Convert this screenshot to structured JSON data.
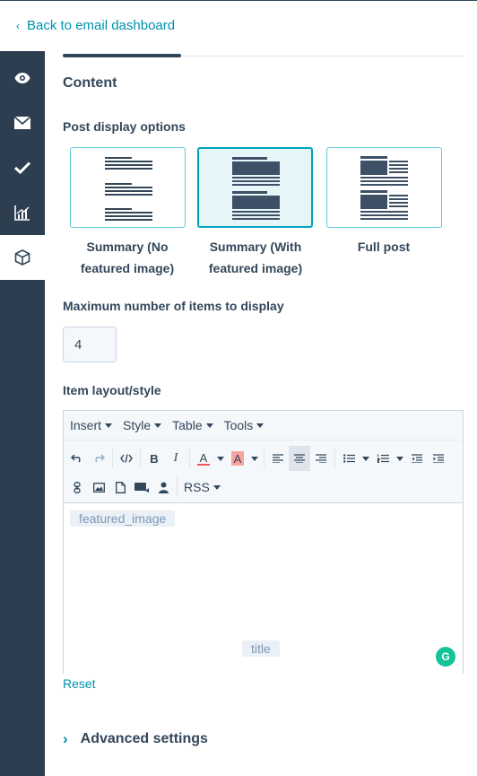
{
  "header": {
    "back_label": "Back to email dashboard",
    "back_icon": "chevron-left-icon"
  },
  "sidebar": {
    "items": [
      {
        "name": "preview",
        "icon": "eye-icon"
      },
      {
        "name": "email",
        "icon": "envelope-icon"
      },
      {
        "name": "review",
        "icon": "checkmark-icon"
      },
      {
        "name": "analytics",
        "icon": "chart-icon"
      },
      {
        "name": "modules",
        "icon": "cube-icon",
        "active": true
      }
    ]
  },
  "panel": {
    "title": "Content",
    "post_display_label": "Post display options",
    "options": [
      {
        "label": "Summary (No featured image)",
        "line1": "Summary (No",
        "line2": "featured image)",
        "selected": false
      },
      {
        "label": "Summary (With featured image)",
        "line1": "Summary (With",
        "line2": "featured image)",
        "selected": true
      },
      {
        "label": "Full post",
        "line1": "Full post",
        "line2": "",
        "selected": false
      }
    ],
    "max_items_label": "Maximum number of items to display",
    "max_items_value": "4",
    "layout_label": "Item layout/style",
    "editor": {
      "menus": [
        "Insert",
        "Style",
        "Table",
        "Tools"
      ],
      "rss_label": "RSS",
      "tokens": {
        "image": "featured_image",
        "title": "title"
      }
    },
    "reset_label": "Reset",
    "advanced_label": "Advanced settings"
  },
  "colors": {
    "accent": "#0091ae",
    "selected_border": "#00a4bd",
    "selected_bg": "#e5f5f8",
    "sidebar": "#2d3e50",
    "text": "#33475b"
  }
}
